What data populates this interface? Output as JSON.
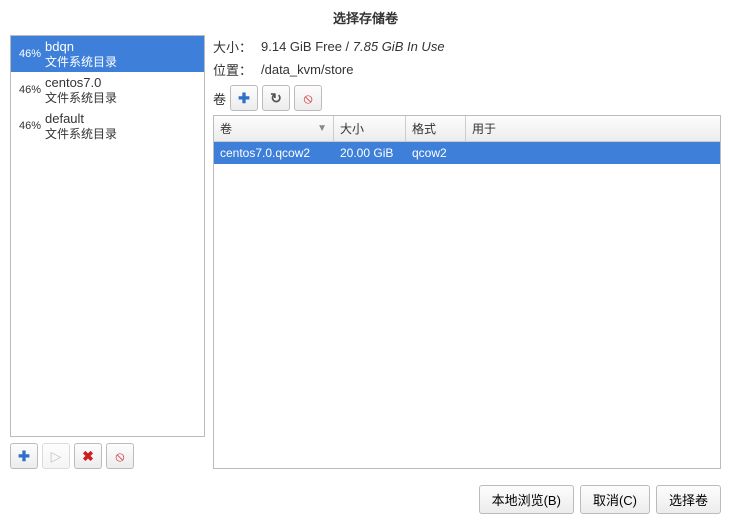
{
  "title": "选择存储卷",
  "pools": [
    {
      "pct": "46%",
      "name": "bdqn",
      "sub": "文件系统目录",
      "selected": true
    },
    {
      "pct": "46%",
      "name": "centos7.0",
      "sub": "文件系统目录",
      "selected": false
    },
    {
      "pct": "46%",
      "name": "default",
      "sub": "文件系统目录",
      "selected": false
    }
  ],
  "left_toolbar": {
    "add": "✚",
    "play": "▷",
    "delete": "✖",
    "stop": "⦸"
  },
  "info": {
    "size_label": "大小：",
    "size_free": "9.14 GiB Free",
    "size_sep": " / ",
    "size_inuse": "7.85 GiB In Use",
    "loc_label": "位置：",
    "loc_val": "/data_kvm/store",
    "vol_label": "卷"
  },
  "vol_toolbar": {
    "add": "✚",
    "refresh": "↻",
    "delete": "⦸"
  },
  "vol_headers": {
    "name": "卷",
    "size": "大小",
    "fmt": "格式",
    "used": "用于"
  },
  "volumes": [
    {
      "name": "centos7.0.qcow2",
      "size": "20.00 GiB",
      "fmt": "qcow2",
      "used": "",
      "selected": true
    }
  ],
  "buttons": {
    "browse": "本地浏览(B)",
    "cancel": "取消(C)",
    "choose": "选择卷"
  }
}
